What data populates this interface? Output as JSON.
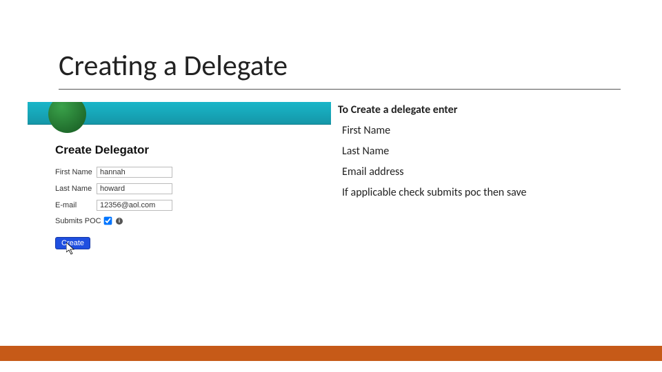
{
  "title": "Creating a Delegate",
  "right": {
    "intro": "To Create a delegate enter",
    "items": [
      "First Name",
      "Last Name",
      "Email address",
      "If applicable check submits poc then save"
    ]
  },
  "form": {
    "title": "Create Delegator",
    "first_label": "First Name",
    "first_value": "hannah",
    "last_label": "Last Name",
    "last_value": "howard",
    "email_label": "E-mail",
    "email_value": "12356@aol.com",
    "poc_label": "Submits POC",
    "create_label": "Create"
  }
}
